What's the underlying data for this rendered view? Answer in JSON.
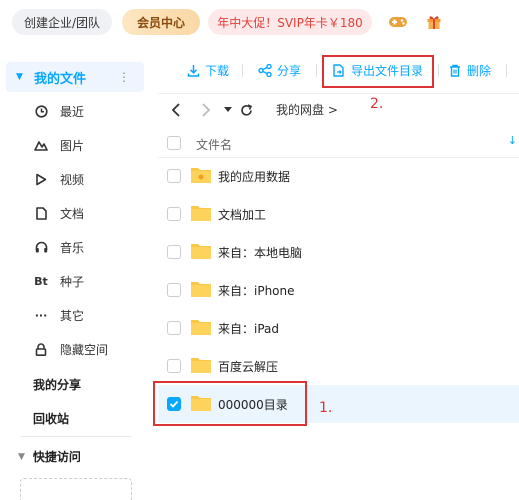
{
  "topbar": {
    "org_label": "创建企业/团队",
    "vip_label": "会员中心",
    "promo_label": "年中大促！SVIP年卡￥180",
    "game_icon": "gamepad-icon",
    "gift_icon": "gift-icon"
  },
  "sidebar": {
    "header_label": "我的文件",
    "more_icon": "⋮",
    "items": [
      {
        "icon": "clock-icon",
        "glyph": "◷",
        "label": "最近"
      },
      {
        "icon": "image-icon",
        "glyph": "△",
        "label": "图片"
      },
      {
        "icon": "play-icon",
        "glyph": "▷",
        "label": "视频"
      },
      {
        "icon": "document-icon",
        "glyph": "▯",
        "label": "文档"
      },
      {
        "icon": "headphones-icon",
        "glyph": "∩",
        "label": "音乐"
      },
      {
        "icon": "bt-icon",
        "glyph": "Bt",
        "label": "种子"
      },
      {
        "icon": "more-icon",
        "glyph": "···",
        "label": "其它"
      },
      {
        "icon": "lock-icon",
        "glyph": "⊡",
        "label": "隐藏空间"
      }
    ],
    "share_label": "我的分享",
    "recycle_label": "回收站",
    "quick_label": "快捷访问"
  },
  "toolbar": {
    "download_label": "下载",
    "share_label": "分享",
    "export_label": "导出文件目录",
    "delete_label": "删除"
  },
  "breadcrumb": {
    "path": "我的网盘 >"
  },
  "file_list": {
    "header_label": "文件名",
    "rows": [
      {
        "name": "我的应用数据",
        "checked": false
      },
      {
        "name": "文档加工",
        "checked": false
      },
      {
        "name": "来自：本地电脑",
        "checked": false
      },
      {
        "name": "来自：iPhone",
        "checked": false
      },
      {
        "name": "来自：iPad",
        "checked": false
      },
      {
        "name": "百度云解压",
        "checked": false
      },
      {
        "name": "000000目录",
        "checked": true
      }
    ]
  },
  "annotations": {
    "step1": "1.",
    "step2": "2."
  },
  "colors": {
    "accent": "#06a7ff",
    "annotation": "#d33333",
    "folder": "#fbc843"
  }
}
